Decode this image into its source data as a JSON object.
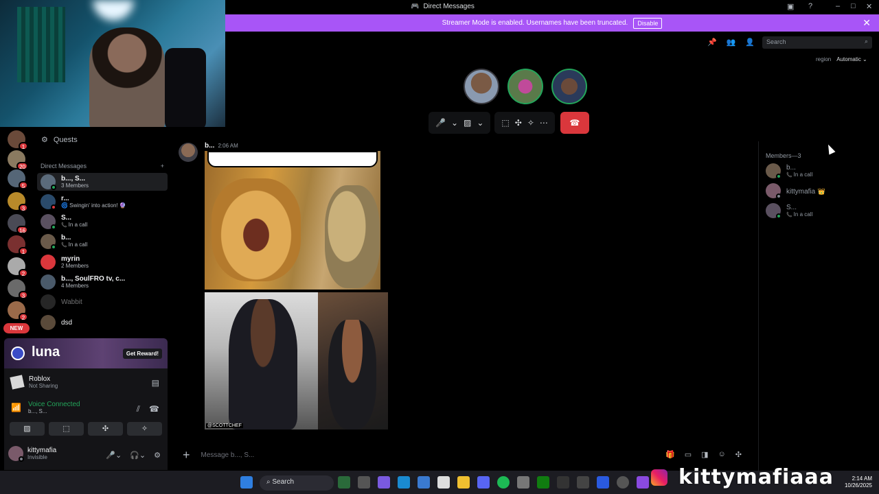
{
  "window": {
    "title": "Direct Messages"
  },
  "banner": {
    "text": "Streamer Mode is enabled. Usernames have been truncated.",
    "disable_label": "Disable"
  },
  "server_badges": [
    "1",
    "20",
    "5",
    "3",
    "16",
    "1",
    "2",
    "3",
    "2",
    "1"
  ],
  "new_label": "NEW",
  "sidebar": {
    "quests_label": "Quests",
    "dm_header": "Direct Messages",
    "add_icon": "+",
    "items": [
      {
        "name": "b..., S...",
        "sub": "3 Members",
        "active": true
      },
      {
        "name": "r...",
        "sub": "🌀 Swingin' into action! 🔮"
      },
      {
        "name": "S...",
        "sub": "In a call",
        "call": true
      },
      {
        "name": "b...",
        "sub": "In a call",
        "call": true
      },
      {
        "name": "myrin",
        "sub": "2 Members"
      },
      {
        "name": "b..., SoulFRO tv, c...",
        "sub": "4 Members"
      },
      {
        "name": "Wabbit",
        "sub": ""
      },
      {
        "name": "dsd",
        "sub": ""
      }
    ]
  },
  "promo": {
    "brand": "luna",
    "button": "Get Reward!"
  },
  "activity": {
    "game": "Roblox",
    "status": "Not Sharing"
  },
  "voice": {
    "status": "Voice Connected",
    "channel": "b..., S..."
  },
  "user": {
    "name": "kittymafia",
    "status": "Invisible"
  },
  "call": {
    "search_placeholder": "Search",
    "region_label": "region",
    "region_value": "Automatic ⌄"
  },
  "message": {
    "author": "b...",
    "time": "2:06 AM",
    "image_tag": "@SCOTTCHEF",
    "composer_placeholder": "Message b..., S..."
  },
  "members": {
    "header": "Members—3",
    "list": [
      {
        "name": "b...",
        "status": "In a call"
      },
      {
        "name": "kittymafia",
        "status": "",
        "crown": "👑"
      },
      {
        "name": "S...",
        "status": "In a call"
      }
    ]
  },
  "taskbar": {
    "search_label": "Search",
    "time": "2:14 AM",
    "date": "10/26/2025"
  },
  "watermark": "kittymafiaaa",
  "colors": {
    "accent": "#a855f7",
    "online": "#23a55a",
    "danger": "#da373c"
  }
}
